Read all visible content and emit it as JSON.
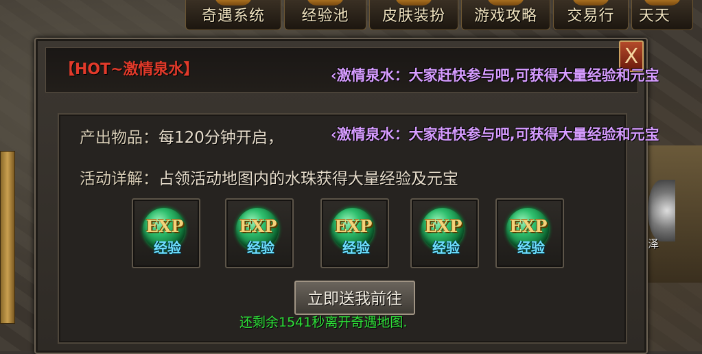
{
  "menu": {
    "items": [
      "奇遇系统",
      "经验池",
      "皮肤装扮",
      "游戏攻略",
      "交易行",
      "天天"
    ]
  },
  "panel": {
    "title": "【HOT~激情泉水】",
    "close_label": "X",
    "output_label": "产出物品：",
    "output_text": "每120分钟开启，",
    "detail_label": "活动详解：",
    "detail_text": "占领活动地图内的水珠获得大量经验及元宝",
    "rewards": [
      {
        "icon": "exp-orb-icon",
        "top_text": "EXP",
        "sub_text": "经验"
      },
      {
        "icon": "exp-orb-icon",
        "top_text": "EXP",
        "sub_text": "经验"
      },
      {
        "icon": "exp-orb-icon",
        "top_text": "EXP",
        "sub_text": "经验"
      },
      {
        "icon": "exp-orb-icon",
        "top_text": "EXP",
        "sub_text": "经验"
      },
      {
        "icon": "exp-orb-icon",
        "top_text": "EXP",
        "sub_text": "经验"
      }
    ],
    "go_button": "立即送我前往",
    "countdown": "还剩余1541秒离开奇遇地图."
  },
  "chat": {
    "line1": "‹激情泉水：大家赶快参与吧,可获得大量经验和元宝",
    "line2": "‹激情泉水：大家赶快参与吧,可获得大量经验和元宝"
  },
  "side": {
    "label": "泽"
  },
  "colors": {
    "title_red": "#e23a2a",
    "chat_purple": "#d69cff",
    "countdown_green": "#2fe23a",
    "exp_gold": "#f4d37a",
    "exp_cyan": "#6fe0ff"
  }
}
